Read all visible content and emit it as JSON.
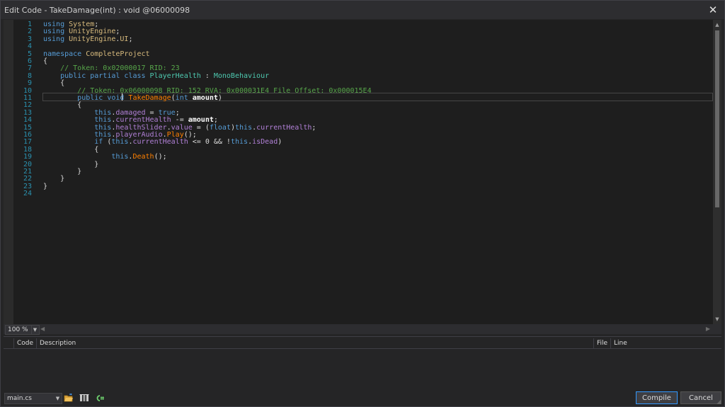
{
  "window": {
    "title": "Edit Code - TakeDamage(int) : void @06000098"
  },
  "editor": {
    "lines": [
      {
        "n": "1",
        "tokens": [
          [
            "kw",
            "using "
          ],
          [
            "ns",
            "System"
          ],
          [
            "",
            ";"
          ]
        ]
      },
      {
        "n": "2",
        "tokens": [
          [
            "kw",
            "using "
          ],
          [
            "ns",
            "UnityEngine"
          ],
          [
            "",
            ";"
          ]
        ]
      },
      {
        "n": "3",
        "tokens": [
          [
            "kw",
            "using "
          ],
          [
            "ns",
            "UnityEngine"
          ],
          [
            "",
            "."
          ],
          [
            "ns",
            "UI"
          ],
          [
            "",
            ";"
          ]
        ]
      },
      {
        "n": "4",
        "tokens": []
      },
      {
        "n": "5",
        "tokens": [
          [
            "kw",
            "namespace "
          ],
          [
            "ns",
            "CompleteProject"
          ]
        ]
      },
      {
        "n": "6",
        "tokens": [
          [
            "",
            "{"
          ]
        ]
      },
      {
        "n": "7",
        "tokens": [
          [
            "",
            "    "
          ],
          [
            "cm",
            "// Token: 0x02000017 RID: 23"
          ]
        ]
      },
      {
        "n": "8",
        "tokens": [
          [
            "",
            "    "
          ],
          [
            "kw",
            "public partial class "
          ],
          [
            "ty",
            "PlayerHealth"
          ],
          [
            "",
            " : "
          ],
          [
            "ty",
            "MonoBehaviour"
          ]
        ]
      },
      {
        "n": "9",
        "tokens": [
          [
            "",
            "    {"
          ]
        ]
      },
      {
        "n": "10",
        "tokens": [
          [
            "",
            "        "
          ],
          [
            "cm",
            "// Token: 0x06000098 RID: 152 RVA: 0x000031E4 File Offset: 0x000015E4"
          ]
        ]
      },
      {
        "n": "11",
        "tokens": [
          [
            "",
            "        "
          ],
          [
            "kw",
            "public void "
          ],
          [
            "mt",
            "TakeDamage"
          ],
          [
            "",
            "("
          ],
          [
            "kw",
            "int "
          ],
          [
            "pm",
            "amount"
          ],
          [
            "",
            ")"
          ]
        ]
      },
      {
        "n": "12",
        "tokens": [
          [
            "",
            "        {"
          ]
        ]
      },
      {
        "n": "13",
        "tokens": [
          [
            "",
            "            "
          ],
          [
            "kw",
            "this"
          ],
          [
            "",
            "."
          ],
          [
            "fd",
            "damaged"
          ],
          [
            "",
            " = "
          ],
          [
            "kw",
            "true"
          ],
          [
            "",
            ";"
          ]
        ]
      },
      {
        "n": "14",
        "tokens": [
          [
            "",
            "            "
          ],
          [
            "kw",
            "this"
          ],
          [
            "",
            "."
          ],
          [
            "fd",
            "currentHealth"
          ],
          [
            "",
            " -= "
          ],
          [
            "pm",
            "amount"
          ],
          [
            "",
            ";"
          ]
        ]
      },
      {
        "n": "15",
        "tokens": [
          [
            "",
            "            "
          ],
          [
            "kw",
            "this"
          ],
          [
            "",
            "."
          ],
          [
            "fd",
            "healthSlider"
          ],
          [
            "",
            "."
          ],
          [
            "fd",
            "value"
          ],
          [
            "",
            " = ("
          ],
          [
            "kw",
            "float"
          ],
          [
            "",
            ")"
          ],
          [
            "kw",
            "this"
          ],
          [
            "",
            "."
          ],
          [
            "fd",
            "currentHealth"
          ],
          [
            "",
            ";"
          ]
        ]
      },
      {
        "n": "16",
        "tokens": [
          [
            "",
            "            "
          ],
          [
            "kw",
            "this"
          ],
          [
            "",
            "."
          ],
          [
            "fd",
            "playerAudio"
          ],
          [
            "",
            "."
          ],
          [
            "mt",
            "Play"
          ],
          [
            "",
            "();"
          ]
        ]
      },
      {
        "n": "17",
        "tokens": [
          [
            "",
            "            "
          ],
          [
            "kw",
            "if "
          ],
          [
            "",
            "("
          ],
          [
            "kw",
            "this"
          ],
          [
            "",
            "."
          ],
          [
            "fd",
            "currentHealth"
          ],
          [
            "",
            " <= 0 && !"
          ],
          [
            "kw",
            "this"
          ],
          [
            "",
            "."
          ],
          [
            "fd",
            "isDead"
          ],
          [
            "",
            ")"
          ]
        ]
      },
      {
        "n": "18",
        "tokens": [
          [
            "",
            "            {"
          ]
        ]
      },
      {
        "n": "19",
        "tokens": [
          [
            "",
            "                "
          ],
          [
            "kw",
            "this"
          ],
          [
            "",
            "."
          ],
          [
            "mt",
            "Death"
          ],
          [
            "",
            "();"
          ]
        ]
      },
      {
        "n": "20",
        "tokens": [
          [
            "",
            "            }"
          ]
        ]
      },
      {
        "n": "21",
        "tokens": [
          [
            "",
            "        }"
          ]
        ]
      },
      {
        "n": "22",
        "tokens": [
          [
            "",
            "    }"
          ]
        ]
      },
      {
        "n": "23",
        "tokens": [
          [
            "",
            "}"
          ]
        ]
      },
      {
        "n": "24",
        "tokens": []
      }
    ]
  },
  "status": {
    "zoom": "100 %"
  },
  "errors": {
    "columns": {
      "code": "Code",
      "description": "Description",
      "file": "File",
      "line": "Line"
    }
  },
  "footer": {
    "file": "main.cs",
    "compile_label": "Compile",
    "cancel_label": "Cancel",
    "icons": [
      "open-folder-icon",
      "assembly-references-icon",
      "csharp-script-icon"
    ]
  }
}
